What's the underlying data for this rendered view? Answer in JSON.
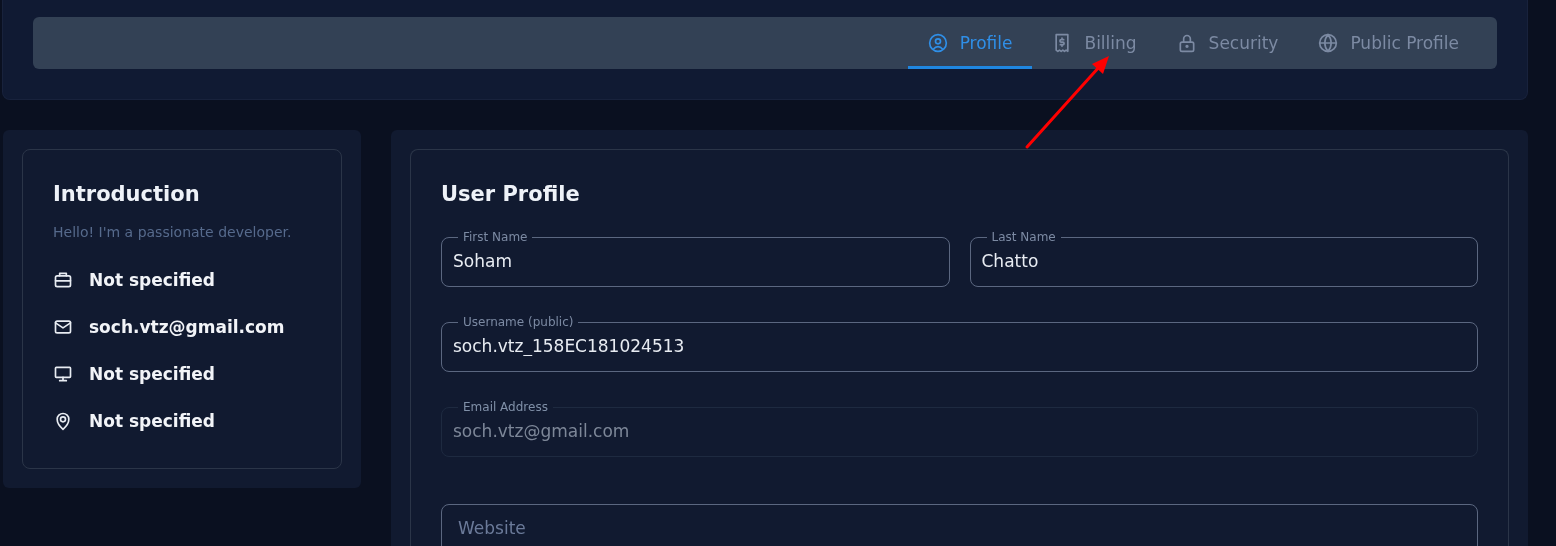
{
  "tabs": [
    {
      "label": "Profile",
      "selected": true
    },
    {
      "label": "Billing",
      "selected": false
    },
    {
      "label": "Security",
      "selected": false
    },
    {
      "label": "Public Profile",
      "selected": false
    }
  ],
  "introduction": {
    "title": "Introduction",
    "bio": "Hello! I'm a passionate developer.",
    "details": [
      "Not specified",
      "soch.vtz@gmail.com",
      "Not specified",
      "Not specified"
    ]
  },
  "user_profile": {
    "title": "User Profile",
    "fields": [
      {
        "label": "First Name",
        "value": "Soham",
        "disabled": false
      },
      {
        "label": "Last Name",
        "value": "Chatto",
        "disabled": false
      },
      {
        "label": "Username (public)",
        "value": "soch.vtz_158EC181024513",
        "disabled": false
      },
      {
        "label": "Email Address",
        "value": "soch.vtz@gmail.com",
        "disabled": true
      },
      {
        "placeholder": "Website",
        "disabled": false
      }
    ]
  }
}
